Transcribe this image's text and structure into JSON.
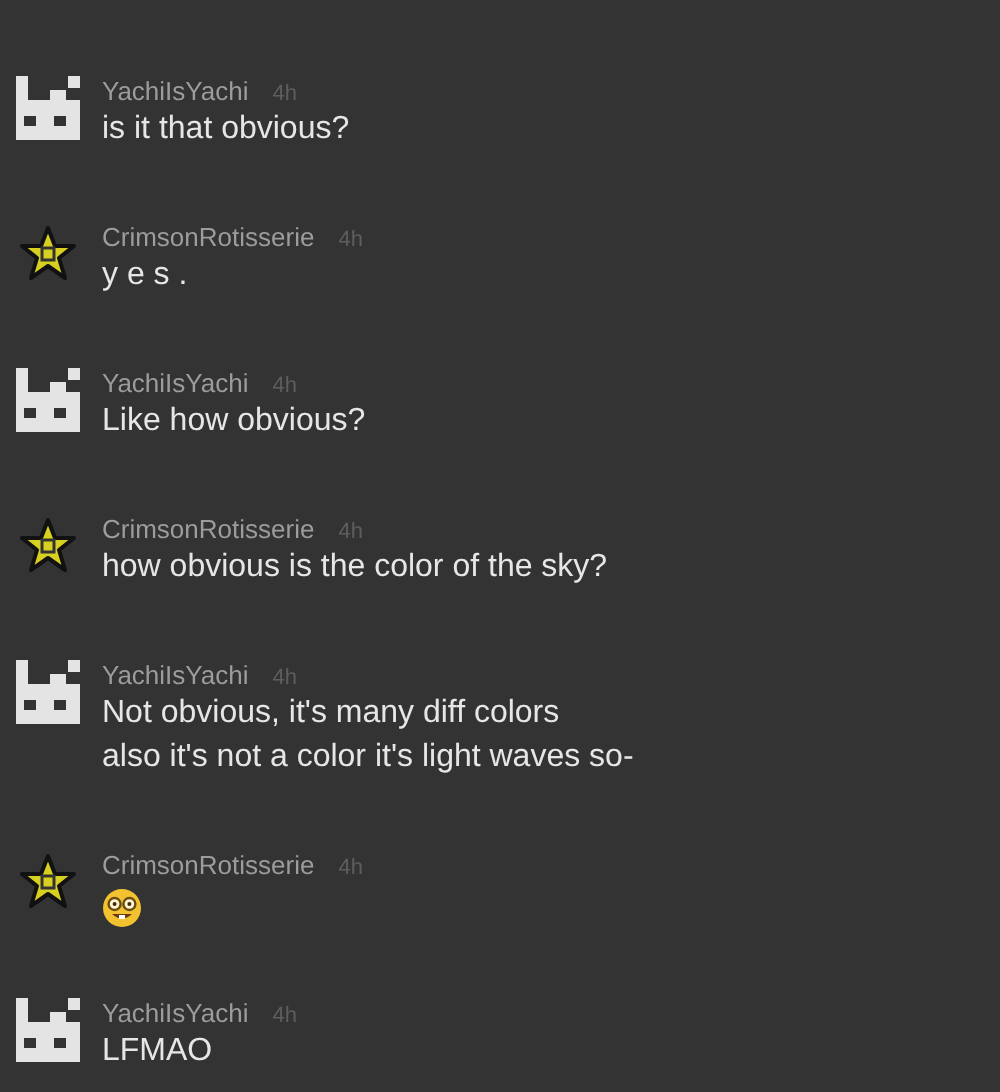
{
  "messages": [
    {
      "avatar": {
        "kind": "blocks"
      },
      "username": "YachiIsYachi",
      "time": "4h",
      "kind": "text",
      "lines": [
        "is it that obvious?"
      ]
    },
    {
      "avatar": {
        "kind": "star"
      },
      "username": "CrimsonRotisserie",
      "time": "4h",
      "kind": "text",
      "lines": [
        "y e s ."
      ]
    },
    {
      "avatar": {
        "kind": "blocks"
      },
      "username": "YachiIsYachi",
      "time": "4h",
      "kind": "text",
      "lines": [
        "Like how obvious?"
      ]
    },
    {
      "avatar": {
        "kind": "star"
      },
      "username": "CrimsonRotisserie",
      "time": "4h",
      "kind": "text",
      "lines": [
        "how obvious is the color of the sky?"
      ]
    },
    {
      "avatar": {
        "kind": "blocks"
      },
      "username": "YachiIsYachi",
      "time": "4h",
      "kind": "text",
      "lines": [
        "Not obvious, it's many diff colors",
        "also it's not a color it's light waves so-"
      ]
    },
    {
      "avatar": {
        "kind": "star"
      },
      "username": "CrimsonRotisserie",
      "time": "4h",
      "kind": "emoji"
    },
    {
      "avatar": {
        "kind": "blocks"
      },
      "username": "YachiIsYachi",
      "time": "4h",
      "kind": "text",
      "lines": [
        "LFMAO"
      ]
    }
  ]
}
